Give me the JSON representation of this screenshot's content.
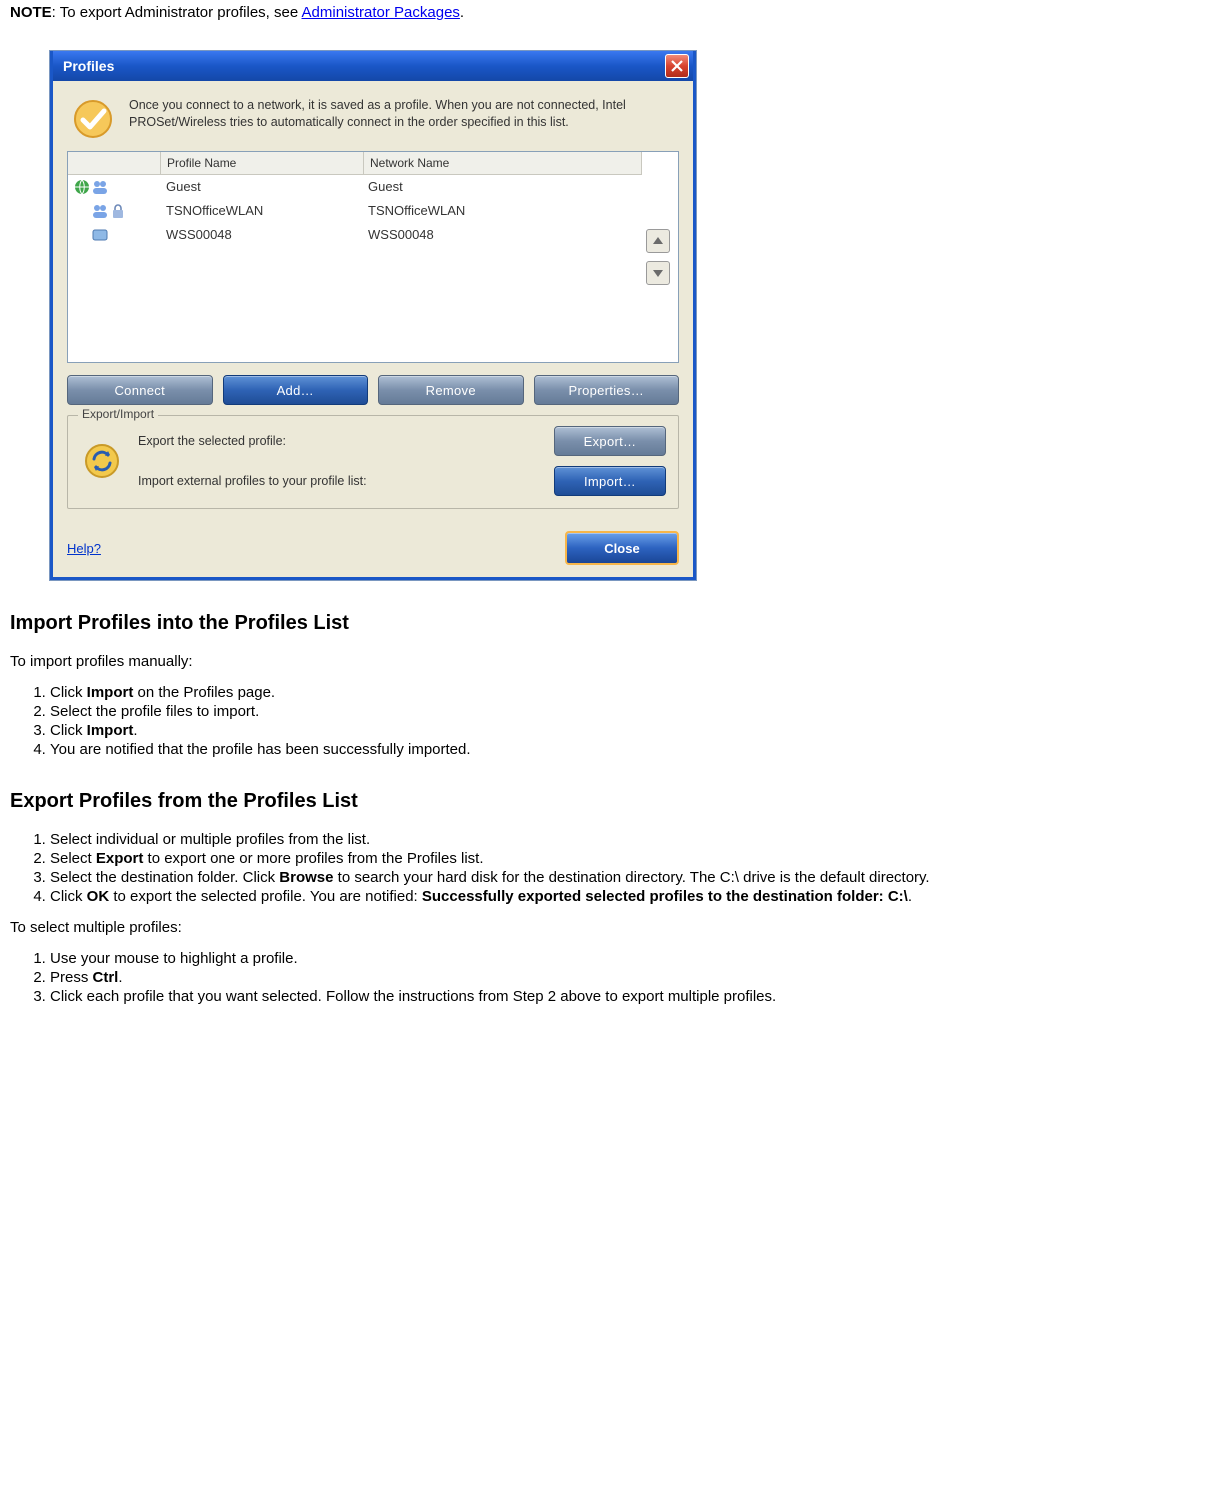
{
  "note": {
    "bold": "NOTE",
    "text_before": ": To export Administrator profiles, see ",
    "link": "Administrator Packages",
    "text_after": "."
  },
  "dialog": {
    "title": "Profiles",
    "intro": "Once you connect to a network, it is saved as a profile. When you are not connected, Intel PROSet/Wireless tries to automatically connect in the order specified in this list.",
    "headers": {
      "profile_name": "Profile Name",
      "network_name": "Network Name"
    },
    "rows": [
      {
        "profile": "Guest",
        "network": "Guest"
      },
      {
        "profile": "TSNOfficeWLAN",
        "network": "TSNOfficeWLAN"
      },
      {
        "profile": "WSS00048",
        "network": "WSS00048"
      }
    ],
    "buttons": {
      "connect": "Connect",
      "add": "Add…",
      "remove": "Remove",
      "properties": "Properties…"
    },
    "export_import": {
      "legend": "Export/Import",
      "export_text": "Export the selected profile:",
      "export_btn": "Export…",
      "import_text": "Import external profiles to your profile list:",
      "import_btn": "Import…"
    },
    "help": "Help?",
    "close": "Close"
  },
  "sec_import": {
    "heading": "Import Profiles into the Profiles List",
    "intro": "To import profiles manually:",
    "steps": [
      {
        "pre": "Click ",
        "bold": "Import",
        "post": " on the Profiles page."
      },
      {
        "pre": "Select the profile files to import.",
        "bold": "",
        "post": ""
      },
      {
        "pre": "Click ",
        "bold": "Import",
        "post": "."
      },
      {
        "pre": "You are notified that the profile has been successfully imported.",
        "bold": "",
        "post": ""
      }
    ]
  },
  "sec_export": {
    "heading": "Export Profiles from the Profiles List",
    "steps": [
      {
        "pre": "Select individual or multiple profiles from the list.",
        "bold": "",
        "post": ""
      },
      {
        "pre": "Select ",
        "bold": "Export",
        "post": " to export one or more profiles from the Profiles list."
      },
      {
        "pre": "Select the destination folder. Click ",
        "bold": "Browse",
        "post": " to search your hard disk for the destination directory. The C:\\ drive is the default directory."
      },
      {
        "pre": "Click ",
        "bold": "OK",
        "post": " to export the selected profile. You are notified: ",
        "bold2": "Successfully exported selected profiles to the destination folder: C:\\",
        "post2": "."
      }
    ]
  },
  "sec_multiple": {
    "intro": "To select multiple profiles:",
    "steps": [
      {
        "pre": "Use your mouse to highlight a profile.",
        "bold": "",
        "post": ""
      },
      {
        "pre": "Press ",
        "bold": "Ctrl",
        "post": "."
      },
      {
        "pre": "Click each profile that you want selected. Follow the instructions from Step 2 above to export multiple profiles.",
        "bold": "",
        "post": ""
      }
    ]
  }
}
